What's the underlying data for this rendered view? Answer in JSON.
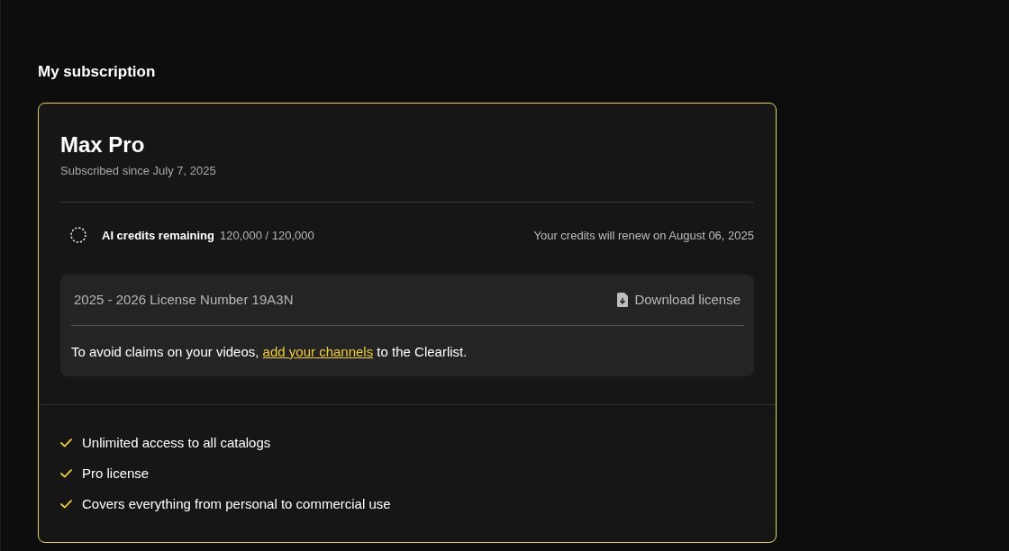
{
  "page": {
    "heading": "My subscription"
  },
  "subscription": {
    "plan": "Max Pro",
    "since": "Subscribed since July 7, 2025",
    "credits": {
      "label": "AI credits remaining",
      "value": "120,000 / 120,000",
      "renewal": "Your credits will renew on August 06, 2025"
    },
    "license": {
      "number": "2025 - 2026 License Number 19A3N",
      "download": "Download license",
      "note": {
        "before": "To avoid claims on your videos, ",
        "link": "add your channels",
        "after": " to the Clearlist."
      }
    },
    "features": [
      "Unlimited access to all catalogs",
      "Pro license",
      "Covers everything from personal to commercial use"
    ]
  }
}
